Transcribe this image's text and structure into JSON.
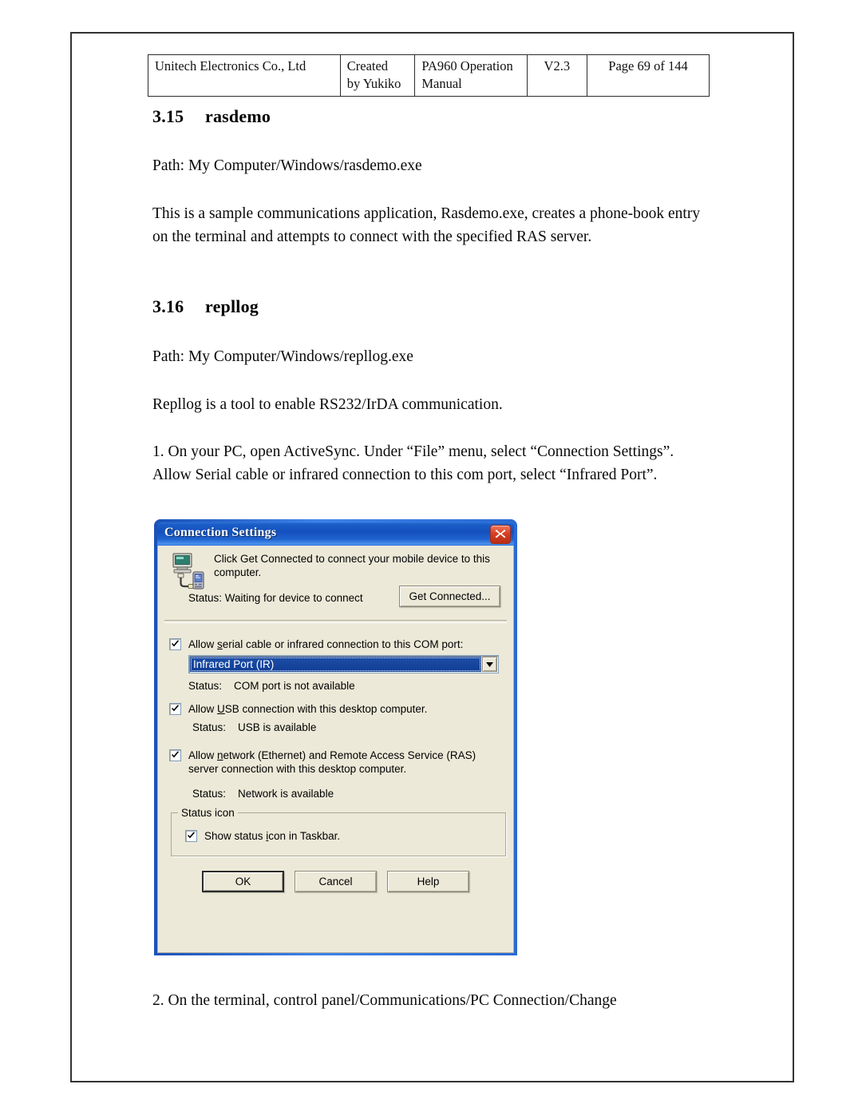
{
  "document_header": {
    "company": "Unitech Electronics Co., Ltd",
    "created_by": "Created\nby Yukiko",
    "manual": "PA960 Operation\nManual",
    "version": "V2.3",
    "page": "Page 69 of 144"
  },
  "sections": [
    {
      "number": "3.15",
      "title": "rasdemo",
      "path": "Path: My Computer/Windows/rasdemo.exe",
      "description": "This is a sample communications application, Rasdemo.exe, creates a phone-book entry on the terminal and attempts to connect with the specified RAS server."
    },
    {
      "number": "3.16",
      "title": "repllog",
      "path": "Path: My Computer/Windows/repllog.exe",
      "description": "Repllog is a tool to enable RS232/IrDA communication.",
      "step1": "1. On your PC, open ActiveSync. Under “File” menu, select “Connection Settings”. Allow Serial cable or infrared connection to this com port, select “Infrared Port”.",
      "step2": "2. On the terminal, control panel/Communications/PC Connection/Change"
    }
  ],
  "dialog": {
    "title": "Connection Settings",
    "close_label": "✕",
    "intro_text": "Click Get Connected to connect your mobile device to this computer.",
    "status_waiting": "Status: Waiting for device to connect",
    "get_connected_label": "Get Connected...",
    "serial_checkbox": {
      "label_pre": "Allow ",
      "label_accel": "s",
      "label_post": "erial cable or infrared connection to this COM port:",
      "checked": true
    },
    "com_port_selected": "Infrared Port (IR)",
    "com_port_options": [
      "Infrared Port (IR)"
    ],
    "status_com": "Status:    COM port is not available",
    "usb_checkbox": {
      "label_pre": "Allow ",
      "label_accel": "U",
      "label_post": "SB connection with this desktop computer.",
      "checked": true
    },
    "status_usb": "Status:    USB is available",
    "network_checkbox": {
      "label_pre": "Allow ",
      "label_accel": "n",
      "label_post": "etwork (Ethernet) and Remote Access Service (RAS) server connection with this desktop computer.",
      "checked": true
    },
    "status_network": "Status:    Network is available",
    "status_icon_group_label": "Status icon",
    "taskbar_checkbox": {
      "label_pre": "Show status ",
      "label_accel": "i",
      "label_post": "con in Taskbar.",
      "checked": true
    },
    "buttons": {
      "ok": "OK",
      "cancel": "Cancel",
      "help": "Help"
    },
    "colors": {
      "titlebar": "#1450bd",
      "face": "#ece9d8",
      "selection": "#0f3d95",
      "close_button": "#d93f23"
    }
  }
}
